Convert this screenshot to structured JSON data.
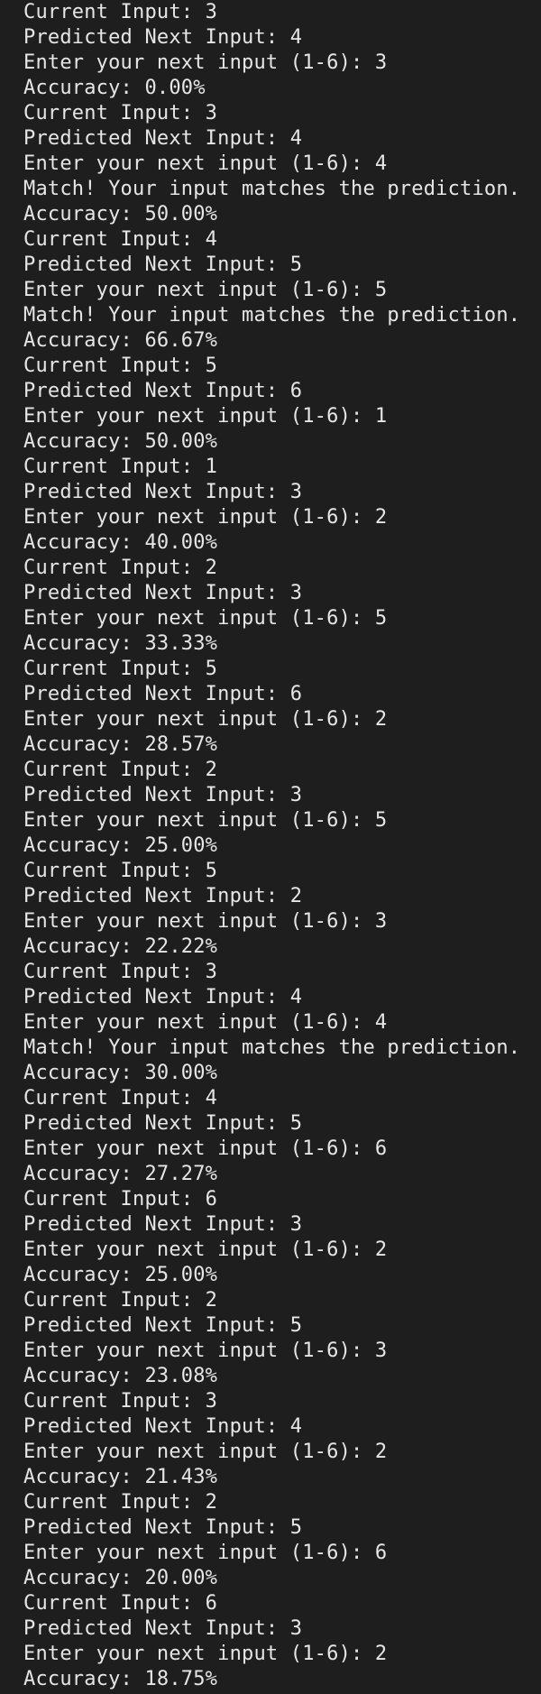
{
  "terminal": {
    "lines": [
      "Current Input: 3",
      "Predicted Next Input: 4",
      "Enter your next input (1-6): 3",
      "Accuracy: 0.00%",
      "Current Input: 3",
      "Predicted Next Input: 4",
      "Enter your next input (1-6): 4",
      "Match! Your input matches the prediction.",
      "Accuracy: 50.00%",
      "Current Input: 4",
      "Predicted Next Input: 5",
      "Enter your next input (1-6): 5",
      "Match! Your input matches the prediction.",
      "Accuracy: 66.67%",
      "Current Input: 5",
      "Predicted Next Input: 6",
      "Enter your next input (1-6): 1",
      "Accuracy: 50.00%",
      "Current Input: 1",
      "Predicted Next Input: 3",
      "Enter your next input (1-6): 2",
      "Accuracy: 40.00%",
      "Current Input: 2",
      "Predicted Next Input: 3",
      "Enter your next input (1-6): 5",
      "Accuracy: 33.33%",
      "Current Input: 5",
      "Predicted Next Input: 6",
      "Enter your next input (1-6): 2",
      "Accuracy: 28.57%",
      "Current Input: 2",
      "Predicted Next Input: 3",
      "Enter your next input (1-6): 5",
      "Accuracy: 25.00%",
      "Current Input: 5",
      "Predicted Next Input: 2",
      "Enter your next input (1-6): 3",
      "Accuracy: 22.22%",
      "Current Input: 3",
      "Predicted Next Input: 4",
      "Enter your next input (1-6): 4",
      "Match! Your input matches the prediction.",
      "Accuracy: 30.00%",
      "Current Input: 4",
      "Predicted Next Input: 5",
      "Enter your next input (1-6): 6",
      "Accuracy: 27.27%",
      "Current Input: 6",
      "Predicted Next Input: 3",
      "Enter your next input (1-6): 2",
      "Accuracy: 25.00%",
      "Current Input: 2",
      "Predicted Next Input: 5",
      "Enter your next input (1-6): 3",
      "Accuracy: 23.08%",
      "Current Input: 3",
      "Predicted Next Input: 4",
      "Enter your next input (1-6): 2",
      "Accuracy: 21.43%",
      "Current Input: 2",
      "Predicted Next Input: 5",
      "Enter your next input (1-6): 6",
      "Accuracy: 20.00%",
      "Current Input: 6",
      "Predicted Next Input: 3",
      "Enter your next input (1-6): 2",
      "Accuracy: 18.75%"
    ]
  }
}
